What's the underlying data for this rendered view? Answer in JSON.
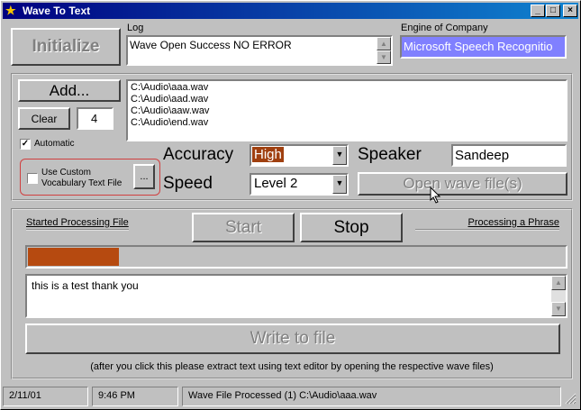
{
  "window": {
    "title": "Wave To Text",
    "title_icon": "wizard-icon"
  },
  "titlebar_buttons": {
    "minimize": "_",
    "maximize": "□",
    "close": "×"
  },
  "top": {
    "initialize_label": "Initialize",
    "log_label": "Log",
    "log_text": "Wave Open Success NO ERROR",
    "engine_label": "Engine of Company",
    "engine_value": "Microsoft Speech Recognitio"
  },
  "files": {
    "add_label": "Add...",
    "clear_label": "Clear",
    "count": "4",
    "list": [
      "C:\\Audio\\aaa.wav",
      "C:\\Audio\\aad.wav",
      "C:\\Audio\\aaw.wav",
      "C:\\Audio\\end.wav"
    ],
    "automatic_label": "Automatic",
    "automatic_checked": "✓",
    "custom_vocab_line1": "Use Custom",
    "custom_vocab_line2": "Vocabulary Text File",
    "browse_label": "..."
  },
  "settings": {
    "accuracy_label": "Accuracy",
    "accuracy_value": "High",
    "speaker_label": "Speaker",
    "speaker_value": "Sandeep",
    "speed_label": "Speed",
    "speed_value": "Level 2",
    "open_wave_label": "Open wave file(s)"
  },
  "processing": {
    "started_label": "Started Processing File",
    "start_label": "Start",
    "stop_label": "Stop",
    "phrase_label": "Processing a Phrase",
    "progress_fraction": 0.17,
    "result_text": "this is a test thank you",
    "write_label": "Write to file",
    "note": "(after you click this please extract text using text editor by opening the respective wave files)"
  },
  "statusbar": {
    "date": "2/11/01",
    "time": "9:46 PM",
    "message": "Wave File Processed (1) C:\\Audio\\aaa.wav"
  },
  "colors": {
    "accent_progress": "#b64a10",
    "engine_bg": "#8080ff",
    "accuracy_bg": "#a04010",
    "vocab_outline": "#d04040"
  }
}
